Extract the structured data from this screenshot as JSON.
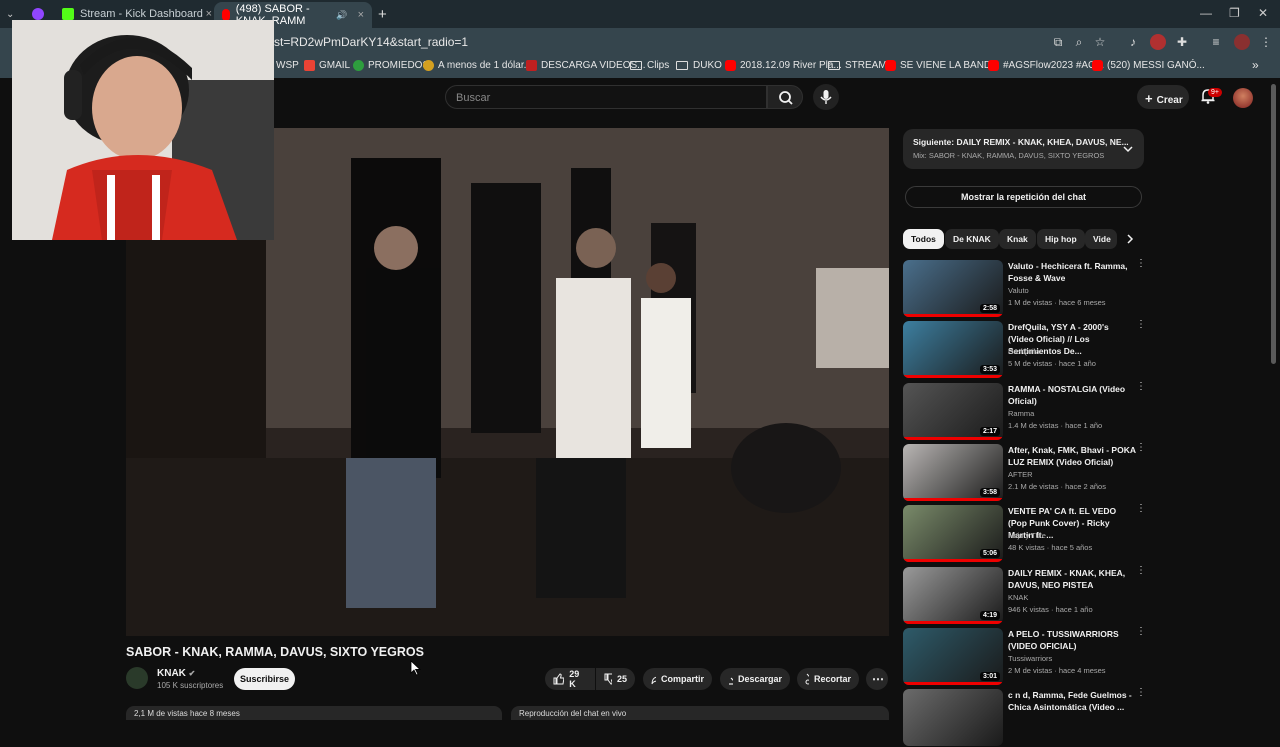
{
  "browser": {
    "tabs": [
      {
        "label": "Stream - Kick Dashboard",
        "close": "×"
      },
      {
        "label": "(498) SABOR - KNAK, RAMM",
        "close": "×"
      }
    ],
    "new_tab": "+",
    "url": "st=RD2wPmDarKY14&start_radio=1",
    "window_controls": [
      "—",
      "❐",
      "✕"
    ],
    "bookmarks": [
      {
        "label": "WSP",
        "icon": "page-icon"
      },
      {
        "label": "GMAIL",
        "icon": "gmail-icon"
      },
      {
        "label": "PROMIEDOS",
        "icon": "promiedos-icon"
      },
      {
        "label": "A menos de 1 dólar...",
        "icon": "coin-icon"
      },
      {
        "label": "DESCARGA VIDEOS...",
        "icon": "download-icon"
      },
      {
        "label": "Clips",
        "icon": "folder-icon"
      },
      {
        "label": "DUKO",
        "icon": "folder-icon"
      },
      {
        "label": "2018.12.09 River Pla...",
        "icon": "youtube-icon"
      },
      {
        "label": "STREAM",
        "icon": "folder-icon"
      },
      {
        "label": "SE VIENE LA BAND...",
        "icon": "youtube-icon"
      },
      {
        "label": "#AGSFlow2023 #AG...",
        "icon": "youtube-icon"
      },
      {
        "label": "(520) MESSI GANÓ...",
        "icon": "youtube-icon"
      }
    ],
    "more_bookmarks": "»"
  },
  "youtube": {
    "search_placeholder": "Buscar",
    "create_label": "Crear",
    "notification_badge": "9+",
    "video": {
      "title": "SABOR - KNAK, RAMMA, DAVUS, SIXTO YEGROS",
      "channel": "KNAK",
      "subscribers": "105 K suscriptores",
      "subscribe_label": "Suscribirse",
      "likes": "29 K",
      "dislikes": "25",
      "share_label": "Compartir",
      "download_label": "Descargar",
      "clip_label": "Recortar",
      "views_date": "2,1 M de vistas  hace 8 meses",
      "chat_replay_box": "Reproducción del chat en vivo"
    },
    "next": {
      "title": "Siguiente: DAILY REMIX - KNAK, KHEA, DAVUS, NE...",
      "subtitle": "Mix: SABOR - KNAK, RAMMA, DAVUS, SIXTO YEGROS"
    },
    "chat_replay_label": "Mostrar la repetición del chat",
    "chips": [
      "Todos",
      "De KNAK",
      "Knak",
      "Hip hop",
      "Vide"
    ],
    "recommendations": [
      {
        "title": "Valuto - Hechicera ft. Ramma, Fosse & Wave",
        "channel": "Valuto",
        "meta": "1 M de vistas · hace 6 meses",
        "duration": "2:58",
        "thumb": "#4a6f8c"
      },
      {
        "title": "DrefQuila, YSY A - 2000's (Video Oficial) // Los Sentimientos De...",
        "channel": "DrefQuila",
        "meta": "5 M de vistas · hace 1 año",
        "duration": "3:53",
        "thumb": "#3d7fa0"
      },
      {
        "title": "RAMMA - NOSTALGIA (Video Oficial)",
        "channel": "Ramma",
        "meta": "1.4 M de vistas · hace 1 año",
        "duration": "2:17",
        "thumb": "#555555"
      },
      {
        "title": "After, Knak, FMK, Bhavi - POKA LUZ REMIX (Video Oficial)",
        "channel": "AFTER",
        "meta": "2.1 M de vistas · hace 2 años",
        "duration": "3:58",
        "thumb": "#b9b6b4"
      },
      {
        "title": "VENTE PA' CA ft. EL VEDO (Pop Punk Cover) - Ricky Martin ft. ...",
        "channel": "Naju y Tute",
        "meta": "48 K vistas · hace 5 años",
        "duration": "5:06",
        "thumb": "#7a8b6a"
      },
      {
        "title": "DAILY REMIX - KNAK, KHEA, DAVUS, NEO PISTEA",
        "channel": "KNAK",
        "meta": "946 K vistas · hace 1 año",
        "duration": "4:19",
        "thumb": "#9a9a9a"
      },
      {
        "title": "A PELO - TUSSIWARRIORS (VIDEO OFICIAL)",
        "channel": "Tussiwarriors",
        "meta": "2 M de vistas · hace 4 meses",
        "duration": "3:01",
        "thumb": "#2e5b6a"
      },
      {
        "title": "c n d, Ramma, Fede Guelmos - Chica Asintomática (Video ...",
        "channel": "",
        "meta": "",
        "duration": "",
        "thumb": "#6b6b6b"
      }
    ]
  }
}
